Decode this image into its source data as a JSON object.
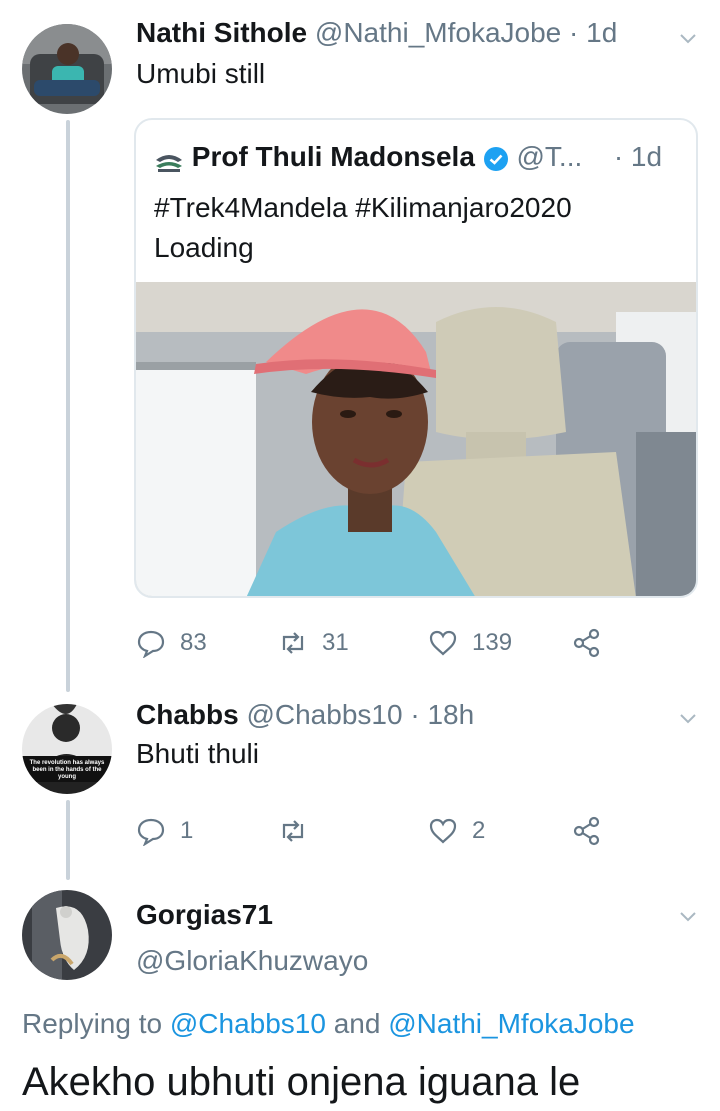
{
  "tweet1": {
    "name": "Nathi Sithole",
    "handle": "@Nathi_MfokaJobe",
    "dot": "·",
    "time": "1d",
    "text": "Umubi still",
    "quote": {
      "name": "Prof Thuli Madonsela",
      "handle": "@T...",
      "dot": "·",
      "time": "1d",
      "line1": "#Trek4Mandela #Kilimanjaro2020",
      "line2": "Loading"
    },
    "stats": {
      "replies": "83",
      "retweets": "31",
      "likes": "139"
    }
  },
  "tweet2": {
    "name": "Chabbs",
    "handle": "@Chabbs10",
    "dot": "·",
    "time": "18h",
    "text": "Bhuti thuli",
    "avatar_text": "The revolution has always been in the hands of the young",
    "stats": {
      "replies": "1",
      "likes": "2"
    }
  },
  "tweet3": {
    "name": "Gorgias71",
    "handle": "@GloriaKhuzwayo",
    "replying_prefix": "Replying to",
    "mention1": "@Chabbs10",
    "and": "and",
    "mention2": "@Nathi_MfokaJobe",
    "text": "Akekho ubhuti onjena iguana le"
  },
  "colors": {
    "accent": "#1b95e0",
    "muted": "#657786",
    "verified": "#1da1f2"
  },
  "icons": [
    "chevron-down-icon",
    "verified-badge-icon",
    "reply-icon",
    "retweet-icon",
    "like-icon",
    "share-icon"
  ]
}
